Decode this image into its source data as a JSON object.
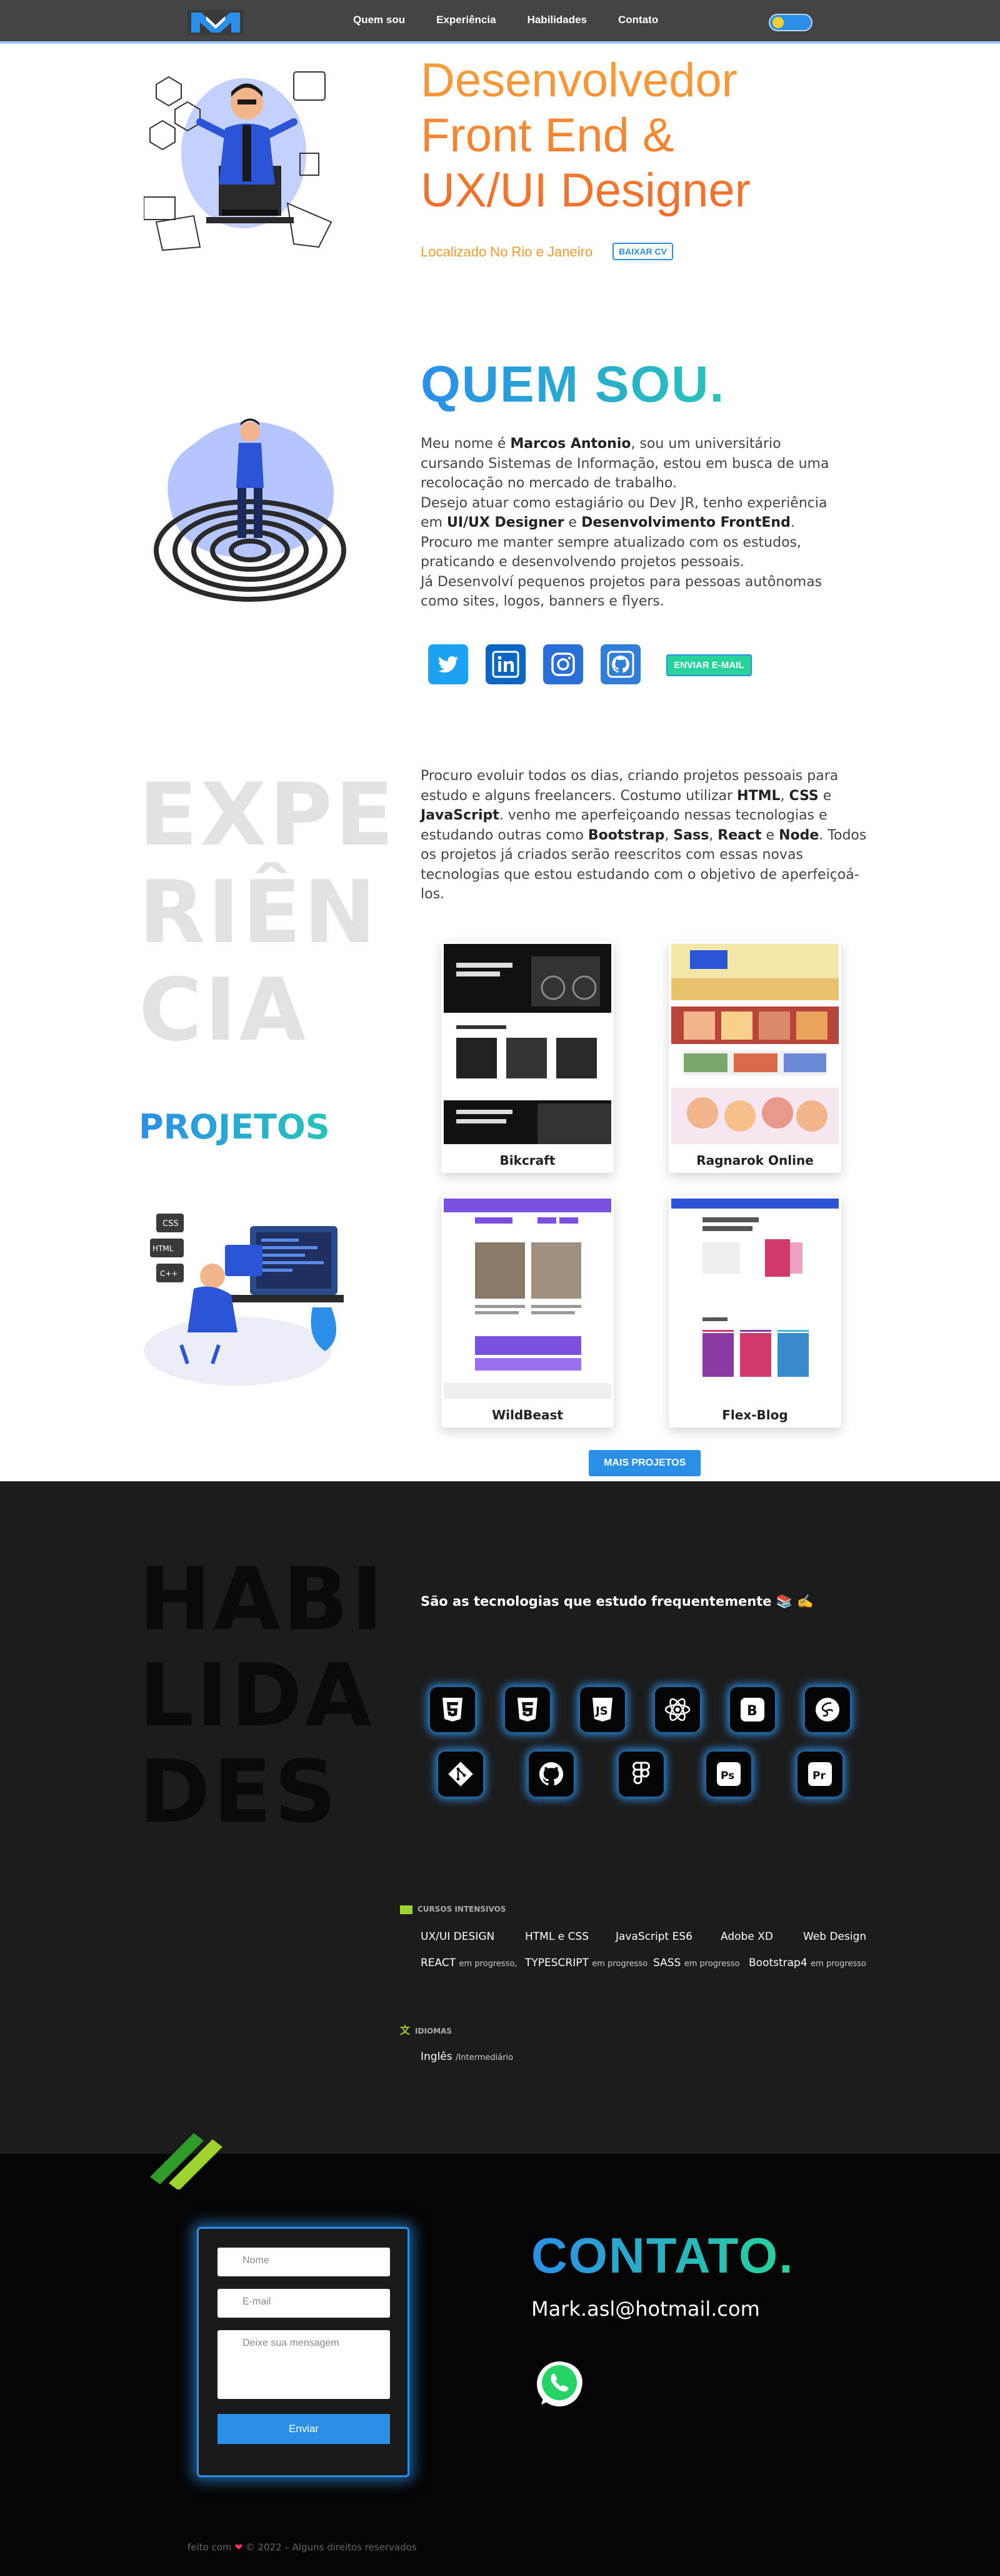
{
  "nav": {
    "links": [
      "Quem sou",
      "Experiência",
      "Habilidades",
      "Contato"
    ]
  },
  "hero": {
    "title_lines": [
      "Desenvolvedor",
      "Front End &",
      "UX/UI Designer"
    ],
    "location": "Localizado No Rio e Janeiro",
    "cv_button": "BAIXAR CV"
  },
  "about": {
    "title": "QUEM SOU.",
    "paragraphs": [
      [
        "Meu nome é ",
        {
          "b": "Marcos Antonio"
        },
        ", sou um universitário cursando Sistemas de Informação, estou em busca de uma recolocação no mercado de trabalho."
      ],
      [
        "Desejo atuar como estagiário ou Dev JR, tenho experiência em ",
        {
          "b": "UI/UX Designer"
        },
        " e ",
        {
          "b": "Desenvolvimento FrontEnd"
        },
        "."
      ],
      [
        "Procuro me manter sempre atualizado com os estudos, praticando e desenvolvendo projetos pessoais."
      ],
      [
        "Já Desenvolví pequenos projetos para pessoas autônomas como sites, logos, banners e flyers."
      ]
    ],
    "email_button": "ENVIAR E-MAIL",
    "social_icons": [
      "twitter-icon",
      "linkedin-icon",
      "instagram-icon",
      "github-icon"
    ]
  },
  "experience": {
    "big_lines": [
      "EXPE",
      "RIÊN",
      "CIA"
    ],
    "text": [
      "Procuro evoluir todos os dias, criando projetos pessoais para estudo e alguns freelancers. Costumo utilizar ",
      {
        "b": "HTML"
      },
      ", ",
      {
        "b": "CSS"
      },
      " e ",
      {
        "b": "JavaScript"
      },
      ". venho me aperfeiçoando nessas tecnologias e estudando outras como ",
      {
        "b": "Bootstrap"
      },
      ", ",
      {
        "b": "Sass"
      },
      ", ",
      {
        "b": "React"
      },
      " e ",
      {
        "b": "Node"
      },
      ". Todos os projetos já criados serão reescritos com essas novas tecnologias que estou estudando com o objetivo de aperfeiçoá-los."
    ],
    "projects_title": "PROJETOS",
    "projects": [
      "Bikcraft",
      "Ragnarok Online",
      "WildBeast",
      "Flex-Blog"
    ],
    "more_button": "MAIS PROJETOS"
  },
  "skills": {
    "big_lines": [
      "HABI",
      "LIDA",
      "DES"
    ],
    "lead": "São as tecnologias que estudo frequentemente 📚 ✍️",
    "icons": [
      "html5-icon",
      "css3-icon",
      "javascript-icon",
      "react-icon",
      "bootstrap-icon",
      "sass-icon",
      "git-icon",
      "github-icon",
      "figma-icon",
      "photoshop-icon",
      "premiere-icon"
    ],
    "courses_heading": "CURSOS INTENSIVOS",
    "courses_row1": [
      "UX/UI DESIGN",
      "HTML e CSS",
      "JavaScript ES6",
      "Adobe XD",
      "Web Design"
    ],
    "courses_row2": [
      {
        "name": "REACT",
        "status": "em progresso,"
      },
      {
        "name": "TYPESCRIPT",
        "status": "em progresso"
      },
      {
        "name": "SASS",
        "status": "em progresso"
      },
      {
        "name": "Bootstrap4",
        "status": "em progresso"
      }
    ],
    "languages_heading": "IDIOMAS",
    "language": "Inglês",
    "language_level": "/Intermediário"
  },
  "contact": {
    "title": "CONTATO.",
    "email": "Mark.asl@hotmail.com",
    "form": {
      "name_placeholder": "Nome",
      "email_placeholder": "E-mail",
      "message_placeholder": "Deixe sua mensagem",
      "submit": "Enviar"
    }
  },
  "footer": {
    "text_before": "feito com",
    "text_after": "© 2022 – Alguns direitos reservados"
  },
  "colors": {
    "accent": "#2b8fe8",
    "hero_orange": "#f47d2d",
    "dark": "#1c1c1c",
    "green": "#27d39b"
  }
}
